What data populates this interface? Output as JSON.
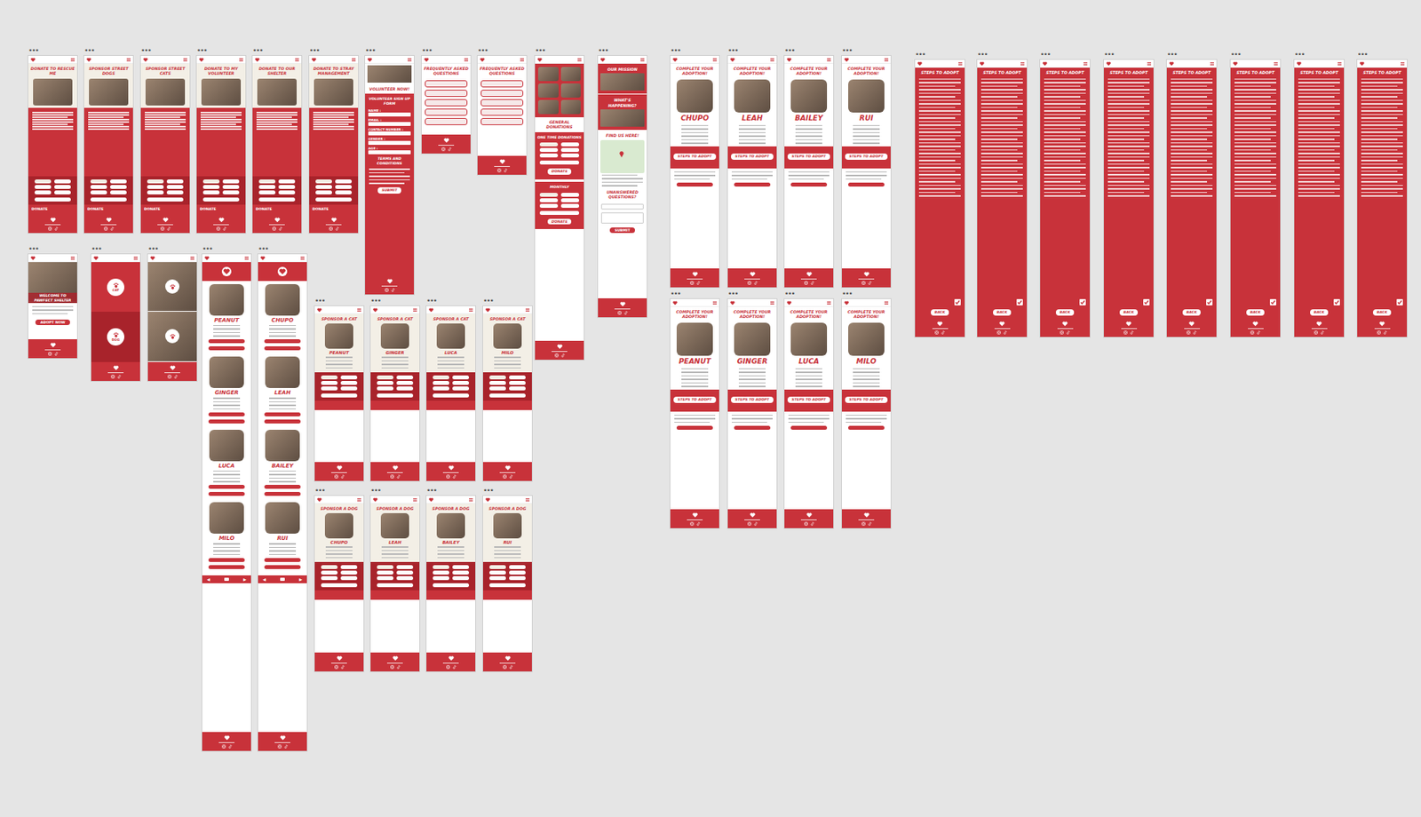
{
  "menu_glyph": "•••",
  "frames": [
    {
      "kind": "donate",
      "title": "DONATE TO RESCUE ME",
      "button": "DONATE"
    },
    {
      "kind": "donate",
      "title": "SPONSOR STREET DOGS",
      "button": "DONATE"
    },
    {
      "kind": "donate",
      "title": "SPONSOR STREET CATS",
      "button": "DONATE"
    },
    {
      "kind": "donate",
      "title": "DONATE TO MY VOLUNTEER",
      "button": "DONATE"
    },
    {
      "kind": "donate",
      "title": "DONATE TO OUR SHELTER",
      "button": "DONATE"
    },
    {
      "kind": "donate",
      "title": "DONATE TO STRAY MANAGEMENT",
      "button": "DONATE"
    },
    {
      "kind": "volunteer",
      "title": "VOLUNTEER NOW!",
      "form_title": "VOLUNTEER SIGN UP FORM",
      "fields": [
        "NAME :",
        "EMAIL :",
        "CONTACT NUMBER :",
        "GENDER :",
        "AGE :"
      ],
      "terms": "TERMS AND CONDITIONS",
      "button": "SUBMIT"
    },
    {
      "kind": "faq",
      "title": "FREQUENTLY ASKED QUESTIONS"
    },
    {
      "kind": "faq",
      "title": "FREQUENTLY ASKED QUESTIONS"
    },
    {
      "kind": "donations",
      "title": "GENERAL DONATIONS",
      "sections": [
        {
          "label": "ONE TIME DONATIONS",
          "button": "DONATE"
        },
        {
          "label": "MONTHLY",
          "button": "DONATE"
        }
      ]
    },
    {
      "kind": "mission",
      "sections": [
        "OUR MISSION",
        "WHAT'S HAPPENING?"
      ],
      "find": "FIND US HERE!",
      "ask": "UNANSWERED QUESTIONS?",
      "button": "SUBMIT"
    },
    {
      "kind": "adopt",
      "title": "COMPLETE YOUR ADOPTION!",
      "name": "CHUPO",
      "button": "STEPS TO ADOPT"
    },
    {
      "kind": "adopt",
      "title": "COMPLETE YOUR ADOPTION!",
      "name": "LEAH",
      "button": "STEPS TO ADOPT"
    },
    {
      "kind": "adopt",
      "title": "COMPLETE YOUR ADOPTION!",
      "name": "BAILEY",
      "button": "STEPS TO ADOPT"
    },
    {
      "kind": "adopt",
      "title": "COMPLETE YOUR ADOPTION!",
      "name": "RUI",
      "button": "STEPS TO ADOPT"
    },
    {
      "kind": "adopt",
      "title": "COMPLETE YOUR ADOPTION!",
      "name": "PEANUT",
      "button": "STEPS TO ADOPT"
    },
    {
      "kind": "adopt",
      "title": "COMPLETE YOUR ADOPTION!",
      "name": "GINGER",
      "button": "STEPS TO ADOPT"
    },
    {
      "kind": "adopt",
      "title": "COMPLETE YOUR ADOPTION!",
      "name": "LUCA",
      "button": "STEPS TO ADOPT"
    },
    {
      "kind": "adopt",
      "title": "COMPLETE YOUR ADOPTION!",
      "name": "MILO",
      "button": "STEPS TO ADOPT"
    },
    {
      "kind": "steps",
      "title": "STEPS TO ADOPT",
      "agreed": true,
      "button": "BACK"
    },
    {
      "kind": "steps",
      "title": "STEPS TO ADOPT",
      "agreed": true,
      "button": "BACK"
    },
    {
      "kind": "steps",
      "title": "STEPS TO ADOPT",
      "agreed": true,
      "button": "BACK"
    },
    {
      "kind": "steps",
      "title": "STEPS TO ADOPT",
      "agreed": true,
      "button": "BACK"
    },
    {
      "kind": "steps",
      "title": "STEPS TO ADOPT",
      "agreed": true,
      "button": "BACK"
    },
    {
      "kind": "steps",
      "title": "STEPS TO ADOPT",
      "agreed": true,
      "button": "BACK"
    },
    {
      "kind": "steps",
      "title": "STEPS TO ADOPT",
      "agreed": true,
      "button": "BACK"
    },
    {
      "kind": "steps",
      "title": "STEPS TO ADOPT",
      "agreed": true,
      "button": "BACK"
    },
    {
      "kind": "welcome",
      "title": "WELCOME TO PAWFECT SHELTER",
      "button": "ADOPT NOW"
    },
    {
      "kind": "choose",
      "options": [
        {
          "label": "CAT"
        },
        {
          "label": "DOG"
        }
      ]
    },
    {
      "kind": "choose-photo"
    },
    {
      "kind": "list",
      "pets": [
        {
          "name": "PEANUT"
        },
        {
          "name": "GINGER"
        },
        {
          "name": "LUCA"
        },
        {
          "name": "MILO"
        }
      ],
      "pager": {
        "prev": "◀",
        "next": "▶"
      }
    },
    {
      "kind": "list",
      "pets": [
        {
          "name": "CHUPO"
        },
        {
          "name": "LEAH"
        },
        {
          "name": "BAILEY"
        },
        {
          "name": "RUI"
        }
      ],
      "pager": {
        "prev": "◀",
        "next": "▶"
      }
    },
    {
      "kind": "sponsor",
      "title": "SPONSOR A CAT",
      "name": "PEANUT"
    },
    {
      "kind": "sponsor",
      "title": "SPONSOR A CAT",
      "name": "GINGER"
    },
    {
      "kind": "sponsor",
      "title": "SPONSOR A CAT",
      "name": "LUCA"
    },
    {
      "kind": "sponsor",
      "title": "SPONSOR A CAT",
      "name": "MILO"
    },
    {
      "kind": "sponsor",
      "title": "SPONSOR A DOG",
      "name": "CHUPO"
    },
    {
      "kind": "sponsor",
      "title": "SPONSOR A DOG",
      "name": "LEAH"
    },
    {
      "kind": "sponsor",
      "title": "SPONSOR A DOG",
      "name": "BAILEY"
    },
    {
      "kind": "sponsor",
      "title": "SPONSOR A DOG",
      "name": "RUI"
    }
  ]
}
